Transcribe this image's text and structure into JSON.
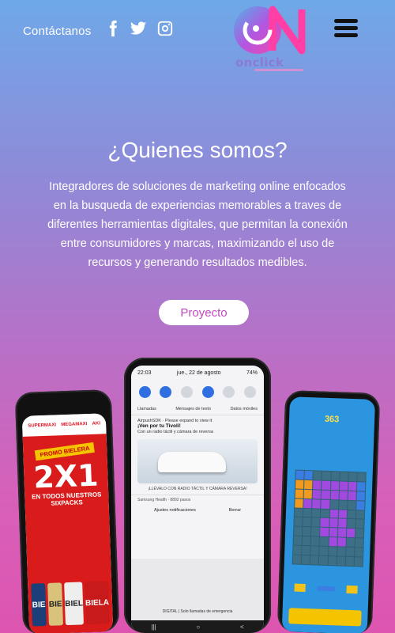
{
  "header": {
    "contact_label": "Contáctanos",
    "logo_text": "onclick",
    "social": [
      "facebook-icon",
      "twitter-icon",
      "instagram-icon"
    ],
    "menu_icon": "hamburger-menu-icon"
  },
  "about": {
    "title": "¿Quienes somos?",
    "description": "Integradores de soluciones de marketing online enfocados en la busqueda de experiencias memorables a traves de diferentes herramientas digitales, que permitan la conexión entre consumidores y marcas, maximizando el uso de recursos y generando resultados medibles.",
    "button_label": "Proyecto"
  },
  "phones": {
    "left": {
      "brands": [
        "SUPERMAXI",
        "MEGAMAXI",
        "AKI"
      ],
      "tag": "PROMO BIELERA",
      "offer": "2X1",
      "offer_sub": "EN TODOS NUESTROS SIXPACKS",
      "cans": [
        "BIE",
        "BIE",
        "BIEL",
        "BIELA"
      ]
    },
    "center": {
      "time": "22:03",
      "date": "jue., 22 de agosto",
      "battery": "74%",
      "sims": [
        "Llamadas",
        "Mensajes de texto",
        "Datos móviles"
      ],
      "notification_app": "AirpushSDK · Please expand to view it",
      "notification_title": "¡Ven por tu Tivoli!",
      "notification_body": "Con un radio táctil y cámara de reversa",
      "ad_caption": "¡LLÉVALO CON RADIO TÁCTIL Y CÁMARA REVERSA!",
      "health": "Samsung Health · 8892 pasos",
      "actions": [
        "Ajustes notificaciones",
        "Borrar"
      ],
      "emergency": "DIGITAL | Solo llamadas de emergencia",
      "nav": [
        "|||",
        "○",
        "<"
      ]
    },
    "right": {
      "score": "363"
    }
  },
  "colors": {
    "accent": "#c34ac0",
    "gradient_top": "#6fa8e8",
    "gradient_bottom": "#dd55b0"
  }
}
